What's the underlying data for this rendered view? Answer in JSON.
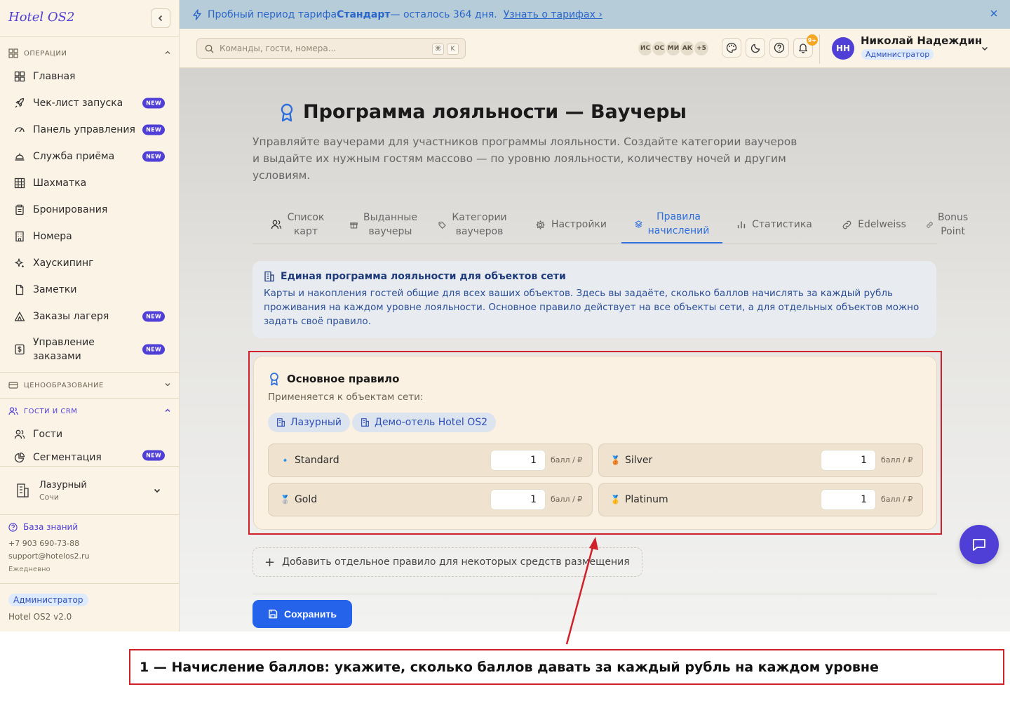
{
  "app": {
    "logo": "Hotel OS2"
  },
  "sidebar": {
    "sections": {
      "operations": "ОПЕРАЦИИ",
      "pricing": "ЦЕНООБРАЗОВАНИЕ",
      "guests_crm": "ГОСТИ И CRM"
    },
    "badge": "NEW",
    "items": [
      {
        "label": "Главная",
        "icon": "grid-icon",
        "new": false
      },
      {
        "label": "Чек-лист запуска",
        "icon": "rocket-icon",
        "new": true
      },
      {
        "label": "Панель управления",
        "icon": "gauge-icon",
        "new": true
      },
      {
        "label": "Служба приёма",
        "icon": "bell-desk-icon",
        "new": true
      },
      {
        "label": "Шахматка",
        "icon": "table-grid-icon",
        "new": false
      },
      {
        "label": "Бронирования",
        "icon": "clipboard-icon",
        "new": false
      },
      {
        "label": "Номера",
        "icon": "building-icon",
        "new": false
      },
      {
        "label": "Хаускипинг",
        "icon": "sparkles-icon",
        "new": false
      },
      {
        "label": "Заметки",
        "icon": "file-icon",
        "new": false
      },
      {
        "label": "Заказы лагеря",
        "icon": "tent-icon",
        "new": true
      },
      {
        "label": "Управление\nзаказами",
        "icon": "dollar-icon",
        "new": true
      }
    ],
    "crm_items": [
      {
        "label": "Гости",
        "icon": "users-icon",
        "new": false
      },
      {
        "label": "Сегментация",
        "icon": "pie-icon",
        "new": true
      }
    ],
    "hotel": {
      "name": "Лазурный",
      "city": "Сочи"
    },
    "knowledge_base": "База знаний",
    "phone": "+7 903 690-73-88",
    "email": "support@hotelos2.ru",
    "hours": "Ежедневно",
    "role": "Администратор",
    "version": "Hotel OS2 v2.0"
  },
  "banner": {
    "prefix": "Пробный период тарифа ",
    "plan": "Стандарт",
    "suffix": " — осталось 364 дня.",
    "link": "Узнать о тарифах ›"
  },
  "header": {
    "search_placeholder": "Команды, гости, номера...",
    "kbd1": "⌘",
    "kbd2": "K",
    "avatars": [
      "ИС",
      "ОС",
      "МИ",
      "АК",
      "+5"
    ],
    "notif_count": "9+",
    "user": {
      "initials": "НН",
      "name": "Николай Надеждин",
      "role": "Администратор"
    }
  },
  "page": {
    "title": "Программа лояльности — Ваучеры",
    "description": "Управляйте ваучерами для участников программы лояльности. Создайте категории ваучеров и выдайте их нужным гостям массово — по уровню лояльности, количеству ночей и другим условиям."
  },
  "tabs": [
    {
      "label": "Список\nкарт",
      "icon": "users-icon",
      "active": false
    },
    {
      "label": "Выданные\nваучеры",
      "icon": "gift-icon",
      "active": false
    },
    {
      "label": "Категории\nваучеров",
      "icon": "tag-icon",
      "active": false
    },
    {
      "label": "Настройки",
      "icon": "gear-icon",
      "active": false
    },
    {
      "label": "Правила\nначислений",
      "icon": "layers-icon",
      "active": true
    },
    {
      "label": "Статистика",
      "icon": "bar-chart-icon",
      "active": false
    },
    {
      "label": "Edelweiss",
      "icon": "link-icon",
      "active": false
    },
    {
      "label": "Bonus\nPoint",
      "icon": "link-icon",
      "active": false
    }
  ],
  "info": {
    "title": "Единая программа лояльности для объектов сети",
    "text": "Карты и накопления гостей общие для всех ваших объектов. Здесь вы задаёте, сколько баллов начислять за каждый рубль проживания на каждом уровне лояльности. Основное правило действует на все объекты сети, а для отдельных объектов можно задать своё правило."
  },
  "rule": {
    "title": "Основное правило",
    "applies_to": "Применяется к объектам сети:",
    "properties": [
      "Лазурный",
      "Демо-отель Hotel OS2"
    ],
    "unit": "балл / ₽",
    "levels": [
      {
        "name": "Standard",
        "emoji": "🔹",
        "value": "1"
      },
      {
        "name": "Silver",
        "emoji": "🥉",
        "value": "1"
      },
      {
        "name": "Gold",
        "emoji": "🥈",
        "value": "1"
      },
      {
        "name": "Platinum",
        "emoji": "🥇",
        "value": "1"
      }
    ]
  },
  "actions": {
    "add_rule": "Добавить отдельное правило для некоторых средств размещения",
    "save": "Сохранить"
  },
  "callout": {
    "text": "1 — Начисление баллов: укажите, сколько баллов давать за каждый рубль на каждом уровне"
  },
  "colors": {
    "accent": "#4f3fd6",
    "primary_button": "#2563eb",
    "active_tab": "#2f6fdb",
    "annotation": "#d0202a"
  }
}
